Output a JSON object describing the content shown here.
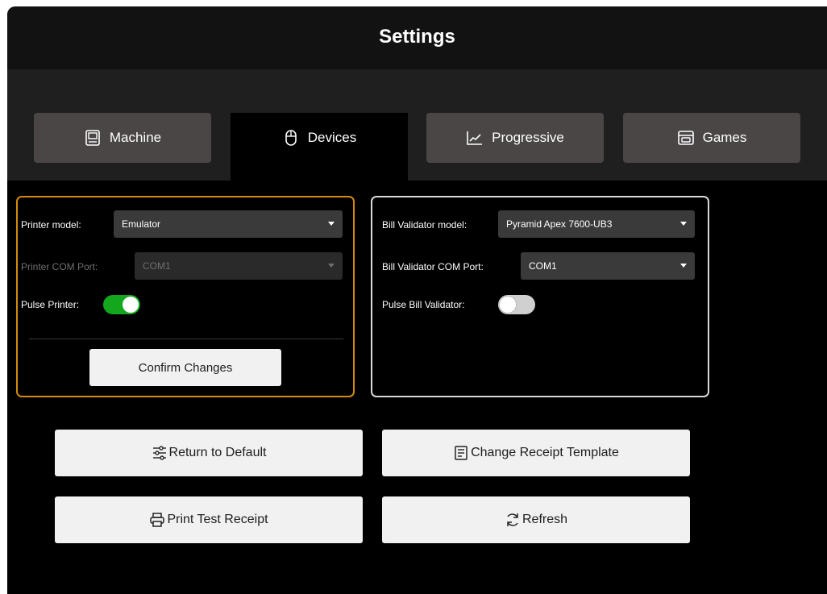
{
  "header": {
    "title": "Settings"
  },
  "tabs": [
    {
      "label": "Machine",
      "icon": "machine-icon",
      "active": false
    },
    {
      "label": "Devices",
      "icon": "mouse-icon",
      "active": true
    },
    {
      "label": "Progressive",
      "icon": "chart-line-icon",
      "active": false
    },
    {
      "label": "Games",
      "icon": "games-icon",
      "active": false
    }
  ],
  "printer_panel": {
    "model_label": "Printer model:",
    "model_value": "Emulator",
    "com_label": "Printer COM Port:",
    "com_value": "COM1",
    "pulse_label": "Pulse Printer:",
    "pulse_on": true,
    "confirm_label": "Confirm Changes",
    "accent_color": "#d58a0e"
  },
  "bill_panel": {
    "model_label": "Bill Validator model:",
    "model_value": "Pyramid Apex 7600-UB3",
    "com_label": "Bill Validator COM Port:",
    "com_value": "COM1",
    "pulse_label": "Pulse Bill Validator:",
    "pulse_on": false
  },
  "actions": {
    "return_default": "Return to Default",
    "change_receipt": "Change Receipt Template",
    "print_test": "Print Test Receipt",
    "refresh": "Refresh"
  },
  "colors": {
    "toggle_on": "#12a71c",
    "tab_bg": "#4a4646"
  }
}
